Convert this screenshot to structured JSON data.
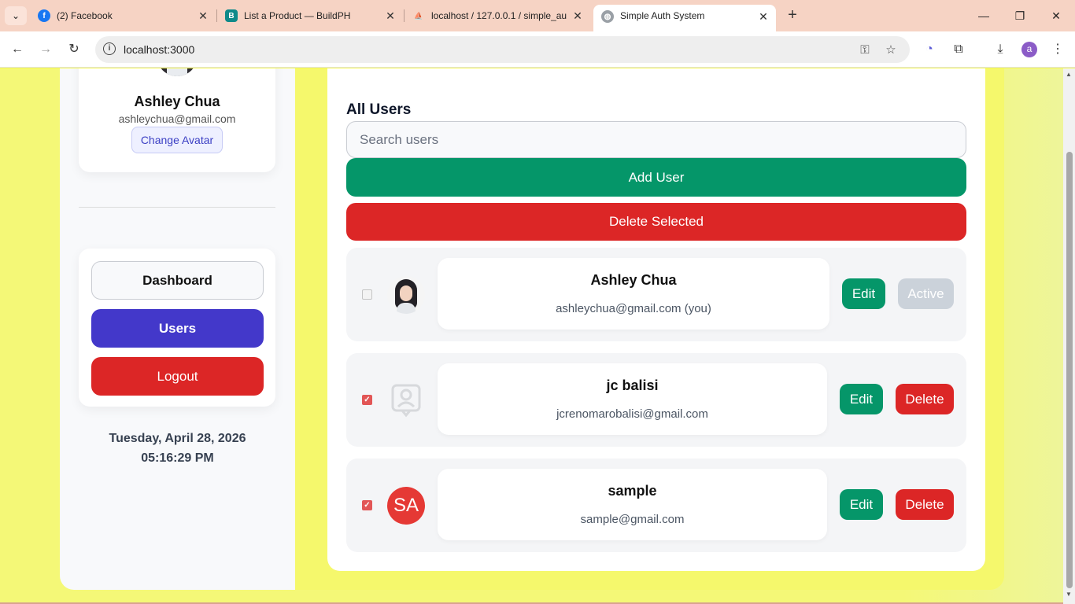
{
  "browser": {
    "tabs": [
      {
        "title": "(2) Facebook",
        "icon": "facebook-icon"
      },
      {
        "title": "List a Product — BuildPH",
        "icon": "buildph-icon"
      },
      {
        "title": "localhost / 127.0.0.1 / simple_au",
        "icon": "phpmyadmin-icon"
      },
      {
        "title": "Simple Auth System",
        "icon": "globe-icon"
      }
    ],
    "url": "localhost:3000",
    "profile_initial": "a",
    "accent_colors": {
      "tabbar": "#f6d3c4",
      "profile": "#8b5cc7"
    }
  },
  "sidebar": {
    "profile": {
      "name": "Ashley Chua",
      "email": "ashleychua@gmail.com",
      "change_avatar_label": "Change Avatar"
    },
    "nav": {
      "dashboard": "Dashboard",
      "users": "Users",
      "logout": "Logout"
    },
    "date": "Tuesday, April 28, 2026",
    "time": "05:16:29 PM"
  },
  "users_panel": {
    "title": "All Users",
    "search_placeholder": "Search users",
    "add_user_label": "Add User",
    "delete_selected_label": "Delete Selected",
    "users": [
      {
        "name": "Ashley Chua",
        "email": "ashleychua@gmail.com (you)",
        "checked": false,
        "avatar": "photo",
        "edit_label": "Edit",
        "status_label": "Active"
      },
      {
        "name": "jc balisi",
        "email": "jcrenomarobalisi@gmail.com",
        "checked": true,
        "avatar": "placeholder",
        "edit_label": "Edit",
        "delete_label": "Delete"
      },
      {
        "name": "sample",
        "email": "sample@gmail.com",
        "checked": true,
        "avatar": "initials",
        "initials": "SA",
        "edit_label": "Edit",
        "delete_label": "Delete"
      }
    ]
  },
  "colors": {
    "primary": "#4338ca",
    "success": "#059669",
    "danger": "#dc2626",
    "page_background": "#f5f84a"
  }
}
